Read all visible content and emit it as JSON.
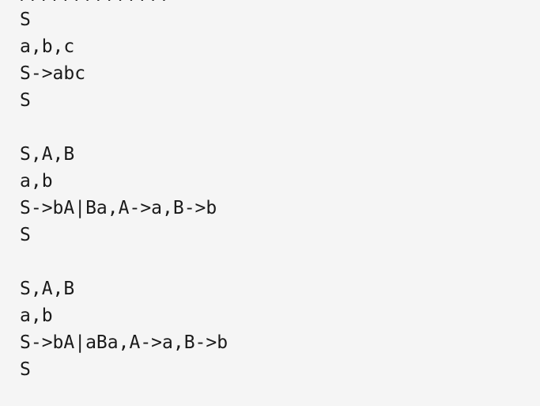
{
  "editor": {
    "clipped_top_line": "//////////////",
    "lines": [
      "S",
      "a,b,c",
      "S->abc",
      "S",
      "",
      "S,A,B",
      "a,b",
      "S->bA|Ba,A->a,B->b",
      "S",
      "",
      "S,A,B",
      "a,b",
      "S->bA|aBa,A->a,B->b",
      "S"
    ]
  }
}
